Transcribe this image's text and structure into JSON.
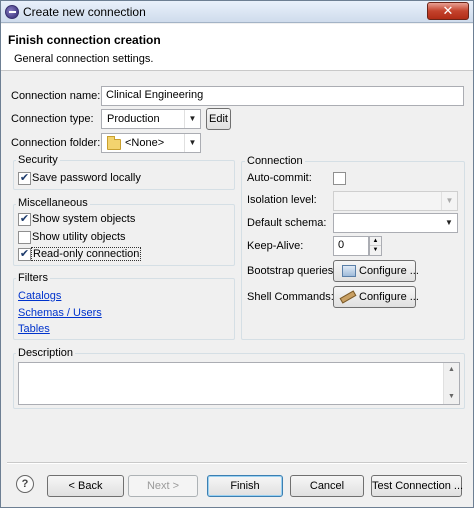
{
  "window": {
    "title": "Create new connection",
    "close_glyph": "✕"
  },
  "header": {
    "title": "Finish connection creation",
    "subtitle": "General connection settings."
  },
  "form": {
    "name_label": "Connection name:",
    "name_value": "Clinical Engineering",
    "type_label": "Connection type:",
    "type_value": "Production",
    "edit_label": "Edit",
    "folder_label": "Connection folder:",
    "folder_value": "<None>"
  },
  "security": {
    "title": "Security",
    "save_password": {
      "label": "Save password locally",
      "checked": true
    }
  },
  "misc": {
    "title": "Miscellaneous",
    "show_system": {
      "label": "Show system objects",
      "checked": true
    },
    "show_utility": {
      "label": "Show utility objects",
      "checked": false
    },
    "read_only": {
      "label": "Read-only connection",
      "checked": true
    }
  },
  "filters": {
    "title": "Filters",
    "links": [
      "Catalogs",
      "Schemas / Users",
      "Tables"
    ]
  },
  "connection": {
    "title": "Connection",
    "auto_commit_label": "Auto-commit:",
    "auto_commit_checked": false,
    "isolation_label": "Isolation level:",
    "isolation_value": "",
    "schema_label": "Default schema:",
    "schema_value": "",
    "keepalive_label": "Keep-Alive:",
    "keepalive_value": "0",
    "bootstrap_label": "Bootstrap queries:",
    "shell_label": "Shell Commands:",
    "configure_label": "Configure ..."
  },
  "description": {
    "title": "Description",
    "value": ""
  },
  "footer": {
    "back_label": "< Back",
    "next_label": "Next >",
    "finish_label": "Finish",
    "cancel_label": "Cancel",
    "test_label": "Test Connection ...",
    "help_glyph": "?"
  },
  "icons": {
    "check_glyph": "✔",
    "dropdown_glyph": "▼",
    "spin_up_glyph": "▲",
    "spin_down_glyph": "▼"
  }
}
